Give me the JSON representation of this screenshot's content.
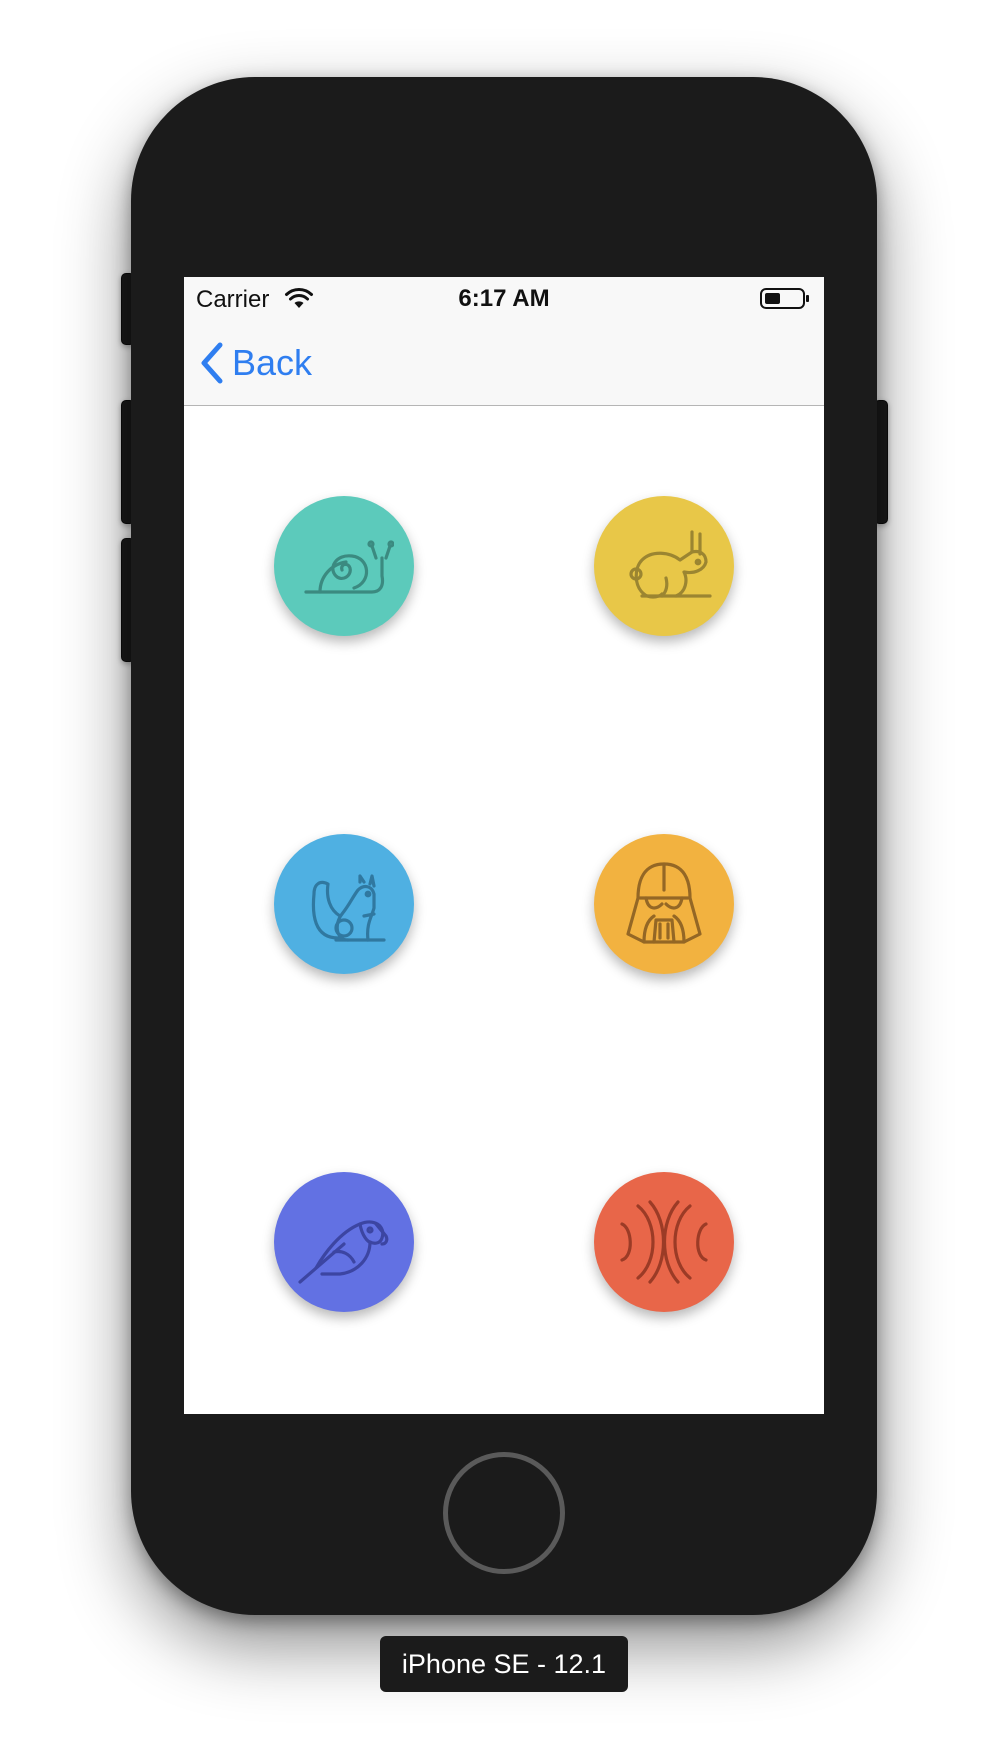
{
  "status_bar": {
    "carrier": "Carrier",
    "time": "6:17 AM",
    "battery_level": 0.4
  },
  "nav": {
    "back_label": "Back"
  },
  "buttons": [
    {
      "icon": "snail-icon",
      "color": "#5ccabb"
    },
    {
      "icon": "rabbit-icon",
      "color": "#e8c748"
    },
    {
      "icon": "squirrel-icon",
      "color": "#4fb0e2"
    },
    {
      "icon": "darth-vader-icon",
      "color": "#f2b240"
    },
    {
      "icon": "parrot-icon",
      "color": "#6271e3"
    },
    {
      "icon": "waves-icon",
      "color": "#e86649"
    }
  ],
  "fab": {
    "icon": "stop-icon",
    "color": "#9be4da"
  },
  "device": {
    "label": "iPhone SE - 12.1"
  }
}
